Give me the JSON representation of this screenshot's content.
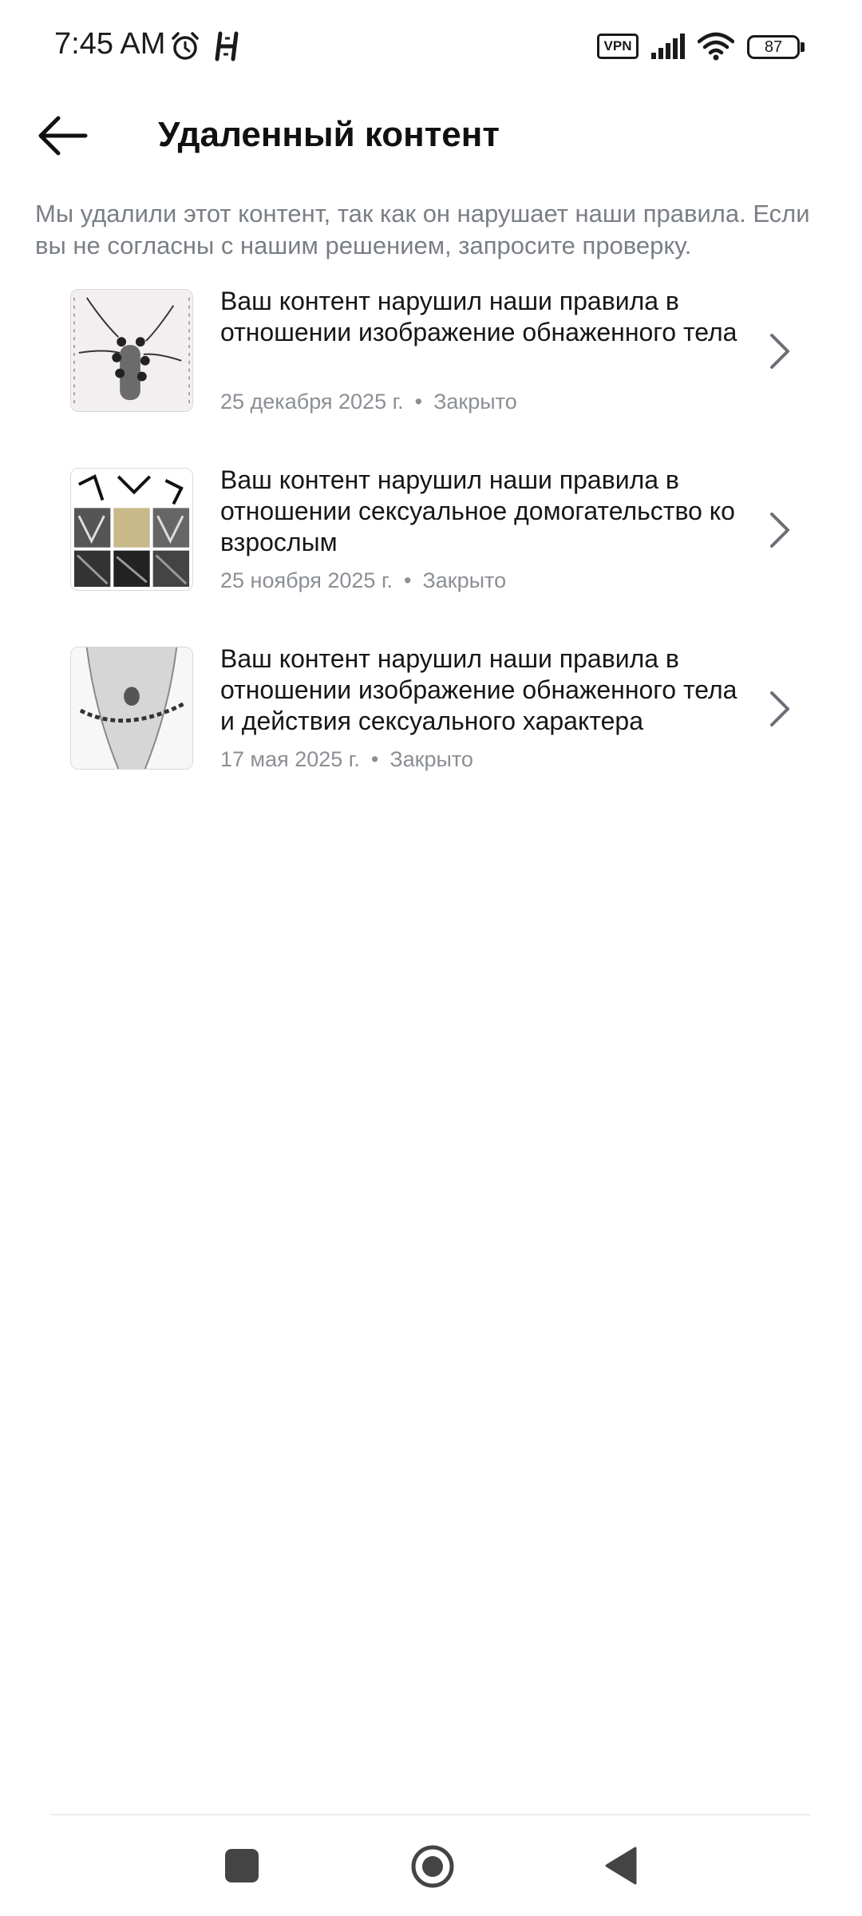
{
  "status_bar": {
    "time": "7:45 AM",
    "vpn_label": "VPN",
    "battery_level": "87",
    "icons": [
      "alarm-icon",
      "h-app-icon",
      "vpn-badge",
      "signal-icon",
      "wifi-icon",
      "battery-icon"
    ]
  },
  "header": {
    "back_icon": "arrow-left-icon",
    "title": "Удаленный контент"
  },
  "description": "Мы удалили этот контент, так как он нарушает наши правила. Если вы не согласны с нашим решением, запросите проверку.",
  "violations": [
    {
      "title": "Ваш контент нарушил наши правила в отношении изображение обнаженного тела",
      "date": "25 декабря 2025 г.",
      "separator": "•",
      "status": "Закрыто"
    },
    {
      "title": "Ваш контент нарушил наши правила в отношении сексуальное домогательство ко взрослым",
      "date": "25 ноября 2025 г.",
      "separator": "•",
      "status": "Закрыто"
    },
    {
      "title": "Ваш контент нарушил наши правила в отношении изображение обнаженного тела и действия сексуального характера",
      "date": "17 мая 2025 г.",
      "separator": "•",
      "status": "Закрыто"
    }
  ],
  "nav_bar": {
    "icons": [
      "recents-square-icon",
      "home-circle-icon",
      "back-triangle-icon"
    ]
  },
  "colors": {
    "title": "#111111",
    "description": "#7a7f85",
    "meta": "#8b8f94",
    "chevron": "#6b6f75",
    "background": "#ffffff"
  }
}
